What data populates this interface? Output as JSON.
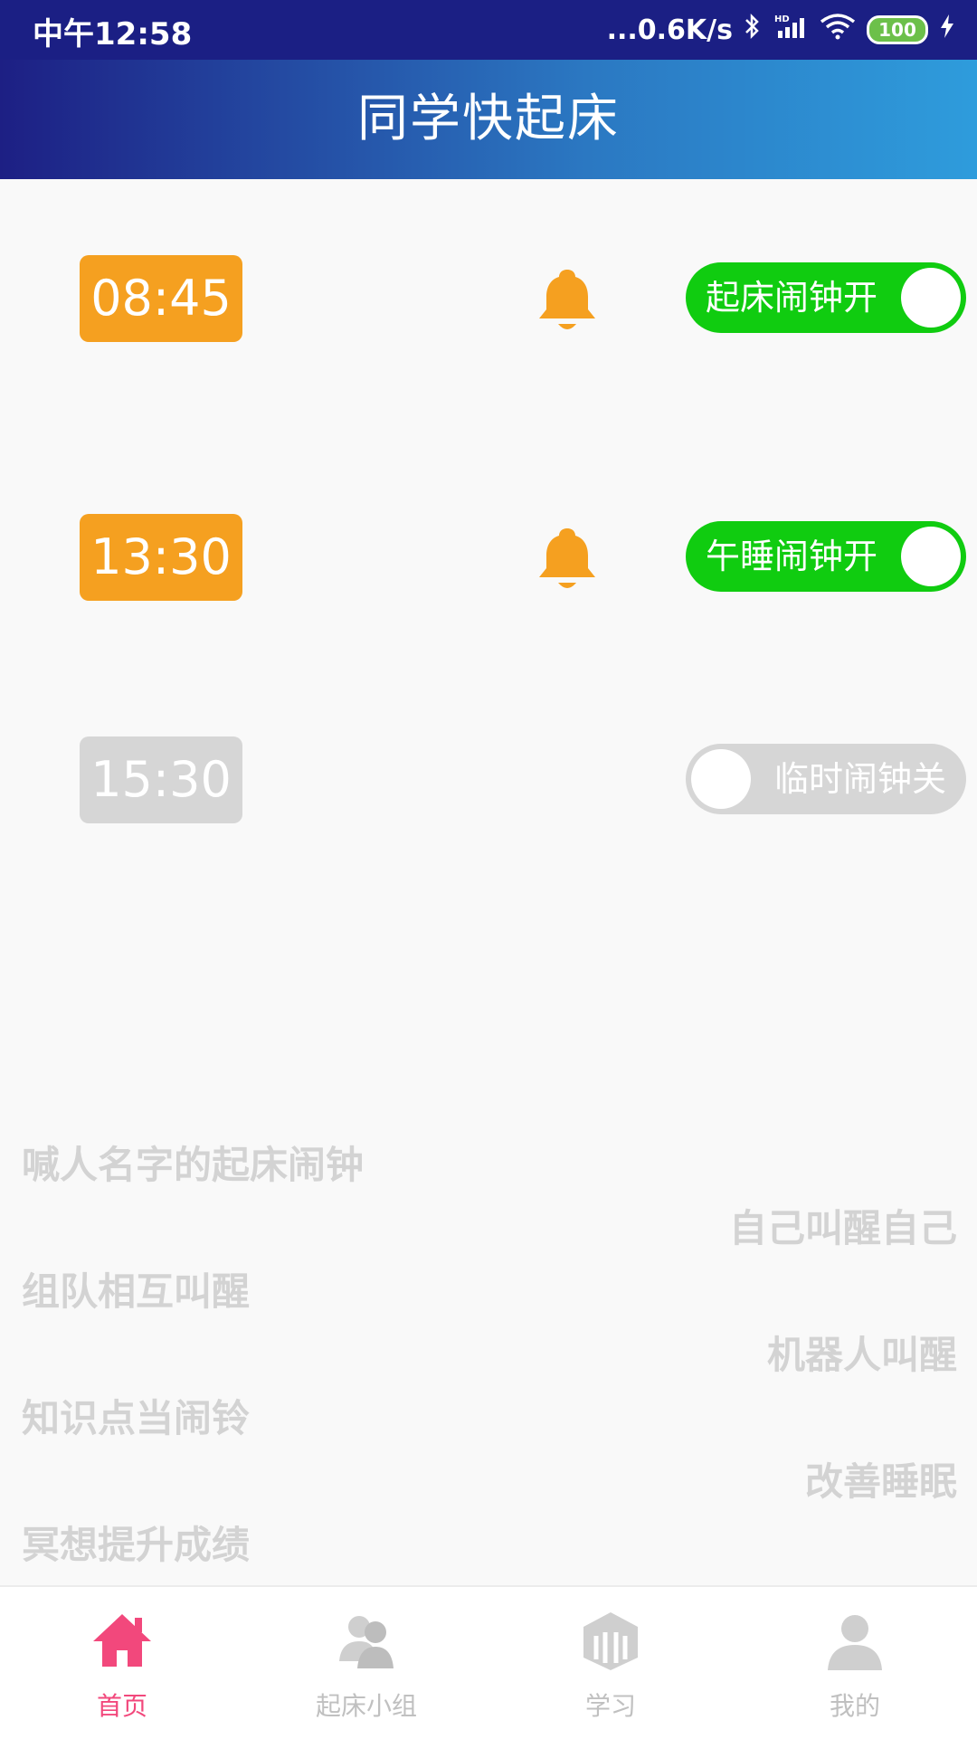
{
  "status_bar": {
    "time": "中午12:58",
    "network_speed": "...0.6K/s",
    "battery": "100",
    "icons": [
      "bluetooth-icon",
      "signal-icon",
      "wifi-icon",
      "battery-icon",
      "charging-icon"
    ]
  },
  "header": {
    "title": "同学快起床"
  },
  "alarms": [
    {
      "time": "08:45",
      "toggle_label": "起床闹钟开",
      "enabled": true,
      "icon": "bell-icon"
    },
    {
      "time": "13:30",
      "toggle_label": "午睡闹钟开",
      "enabled": true,
      "icon": "bell-icon"
    },
    {
      "time": "15:30",
      "toggle_label": "临时闹钟关",
      "enabled": false
    }
  ],
  "features": [
    "喊人名字的起床闹钟",
    "自己叫醒自己",
    "组队相互叫醒",
    "机器人叫醒",
    "知识点当闹铃",
    "改善睡眠",
    "冥想提升成绩"
  ],
  "bottom_nav": [
    {
      "label": "首页",
      "icon": "home-icon",
      "active": true
    },
    {
      "label": "起床小组",
      "icon": "group-icon",
      "active": false
    },
    {
      "label": "学习",
      "icon": "study-icon",
      "active": false
    },
    {
      "label": "我的",
      "icon": "profile-icon",
      "active": false
    }
  ],
  "colors": {
    "header_start": "#1d1f84",
    "header_end": "#2e9cdc",
    "alarm_on": "#f5a020",
    "toggle_on": "#10cc10",
    "disabled": "#d6d6d6",
    "nav_active": "#f2487c",
    "nav_inactive": "#c0c0c0"
  }
}
